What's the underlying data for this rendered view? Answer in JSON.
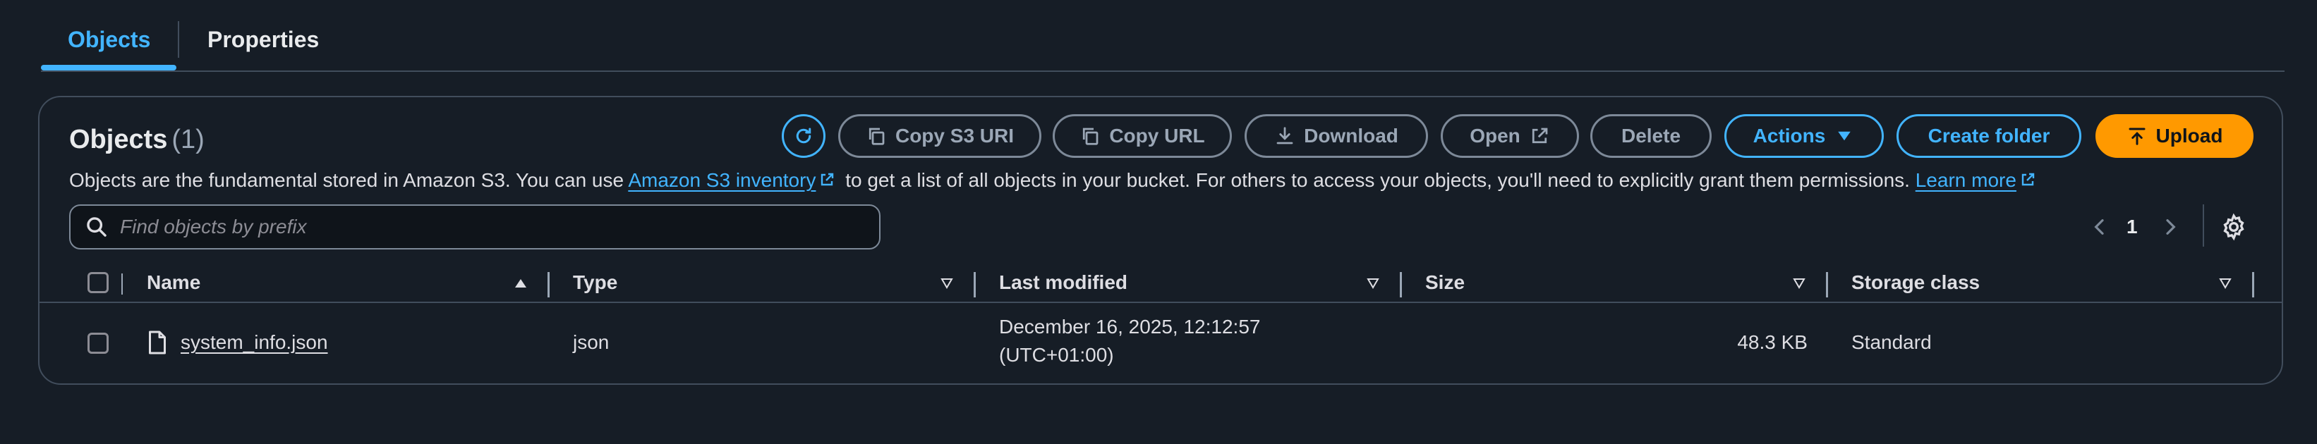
{
  "tabs": [
    {
      "label": "Objects",
      "active": true
    },
    {
      "label": "Properties",
      "active": false
    }
  ],
  "header": {
    "title": "Objects",
    "count": "(1)",
    "description_part1": "Objects are the fundamental stored in Amazon S3. You can use ",
    "description_link1": "Amazon S3 inventory",
    "description_part2": " to get a list of all objects in your bucket. For others to access your objects, you'll need to explicitly grant them permissions. ",
    "description_link2": "Learn more"
  },
  "toolbar": {
    "copy_s3_uri": "Copy S3 URI",
    "copy_url": "Copy URL",
    "download": "Download",
    "open": "Open",
    "delete": "Delete",
    "actions": "Actions",
    "create_folder": "Create folder",
    "upload": "Upload"
  },
  "search": {
    "placeholder": "Find objects by prefix"
  },
  "pagination": {
    "current_page": "1"
  },
  "table": {
    "columns": [
      "Name",
      "Type",
      "Last modified",
      "Size",
      "Storage class"
    ],
    "rows": [
      {
        "name": "system_info.json",
        "type": "json",
        "last_modified_line1": "December 16, 2025, 12:12:57",
        "last_modified_line2": "(UTC+01:00)",
        "size": "48.3 KB",
        "storage_class": "Standard"
      }
    ]
  },
  "colors": {
    "background": "#161d26",
    "accent": "#42b4ff",
    "primary_button": "#ff9900",
    "border": "#414d5c"
  },
  "icons": [
    "refresh-icon",
    "copy-icon",
    "download-icon",
    "external-link-icon",
    "caret-down-icon",
    "upload-icon",
    "search-icon",
    "chevron-left-icon",
    "chevron-right-icon",
    "gear-icon",
    "sort-asc-icon",
    "sort-desc-icon",
    "file-icon"
  ]
}
